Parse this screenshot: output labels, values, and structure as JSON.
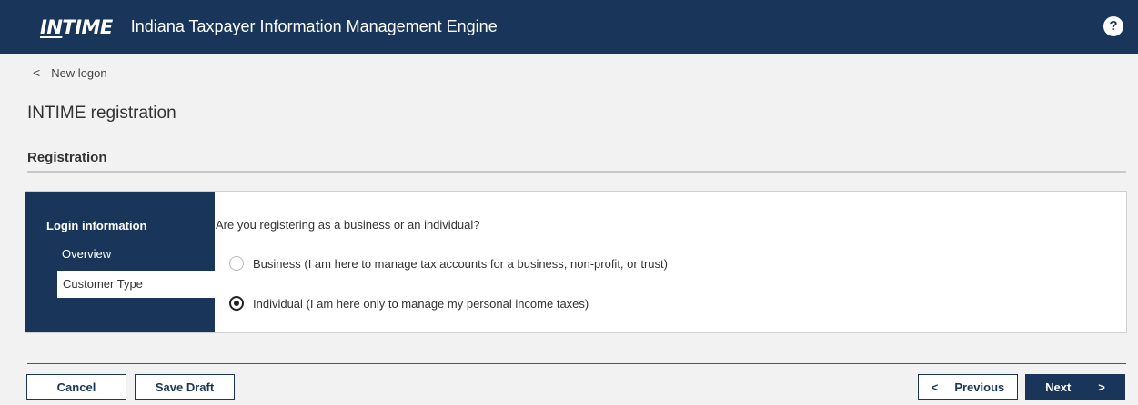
{
  "header": {
    "logo_text_in": "IN",
    "logo_text_rest": "TIME",
    "title": "Indiana Taxpayer Information Management Engine",
    "help_glyph": "?"
  },
  "nav": {
    "back_glyph": "<",
    "back_label": "New logon"
  },
  "page": {
    "title": "INTIME registration",
    "tab_label": "Registration"
  },
  "sidebar": {
    "heading": "Login information",
    "items": [
      {
        "label": "Overview",
        "active": false
      },
      {
        "label": "Customer Type",
        "active": true
      }
    ]
  },
  "form": {
    "question": "Are you registering as a business or an individual?",
    "options": [
      {
        "label": "Business (I am here to manage tax accounts for a business, non-profit, or trust)",
        "checked": false
      },
      {
        "label": "Individual (I am here only to manage my personal income taxes)",
        "checked": true
      }
    ]
  },
  "footer": {
    "cancel_label": "Cancel",
    "save_draft_label": "Save Draft",
    "previous_glyph": "<",
    "previous_label": "Previous",
    "next_label": "Next",
    "next_glyph": ">"
  },
  "colors": {
    "brand_navy": "#19365a",
    "background": "#f2f2f2"
  }
}
